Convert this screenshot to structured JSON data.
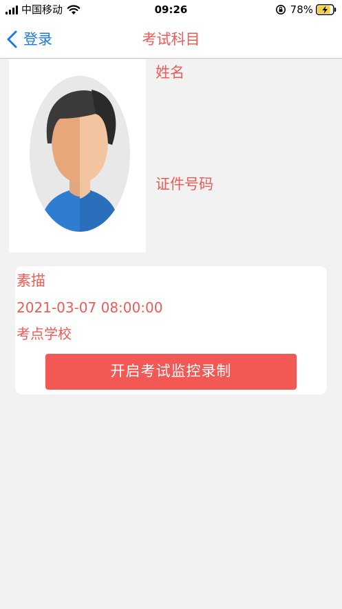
{
  "status_bar": {
    "carrier": "中国移动",
    "time": "09:26",
    "battery_percent": "78%",
    "icons": [
      "signal-icon",
      "wifi-icon",
      "rotation-lock-icon",
      "battery-charging-icon"
    ]
  },
  "nav": {
    "back_label": "登录",
    "title": "考试科目"
  },
  "profile": {
    "name_label": "姓名",
    "id_label": "证件号码",
    "photo_icon": "avatar-icon"
  },
  "exam": {
    "subject": "素描",
    "time": "2021-03-07 08:00:00",
    "site": "考点学校",
    "start_button": "开启考试监控录制"
  },
  "colors": {
    "accent_red": "#f25955",
    "link_blue": "#1a7be0",
    "background": "#f2f2f2"
  }
}
